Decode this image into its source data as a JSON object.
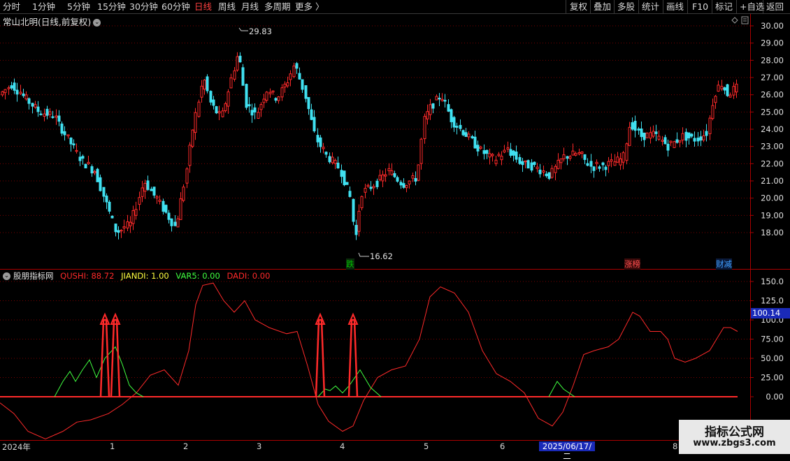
{
  "toolbar": {
    "left_items": [
      "分时",
      "1分钟",
      "5分钟",
      "15分钟",
      "30分钟",
      "60分钟",
      "日线",
      "周线",
      "月线",
      "多周期",
      "更多 〉"
    ],
    "active": "日线",
    "right_items": [
      "复权",
      "叠加",
      "多股",
      "统计",
      "画线",
      "F10",
      "标记",
      "+自选",
      "返回"
    ]
  },
  "price_panel": {
    "title": "常山北明(日线,前复权)",
    "high_label": "29.83",
    "low_label": "16.62",
    "y_ticks": [
      "30.00",
      "29.00",
      "28.00",
      "27.00",
      "26.00",
      "25.00",
      "24.00",
      "23.00",
      "22.00",
      "21.00",
      "20.00",
      "19.00",
      "18.00"
    ],
    "tags": [
      {
        "text": "跌",
        "color": "#00c000"
      },
      {
        "text": "涨榜",
        "color": "#ff5050"
      },
      {
        "text": "财减",
        "color": "#40a0ff"
      }
    ]
  },
  "indicator_panel": {
    "name": "股朋指标网",
    "values": [
      {
        "label": "QUSHI: 88.72",
        "color": "#ff2a2a"
      },
      {
        "label": "JIANDI: 1.00",
        "color": "#ffff40"
      },
      {
        "label": "VAR5: 0.00",
        "color": "#40ff40"
      },
      {
        "label": "DADI: 0.00",
        "color": "#ff2a2a"
      }
    ],
    "y_ticks": [
      "150.0",
      "125.0",
      "100.0",
      "75.00",
      "50.00",
      "25.00",
      "0.00"
    ],
    "current_value": "100.14"
  },
  "x_axis": {
    "labels": [
      "2024年",
      "1",
      "2",
      "3",
      "4",
      "5",
      "6",
      "8"
    ],
    "cursor_date": "2025/06/17/二"
  },
  "watermark": {
    "title": "指标公式网",
    "url": "www.zbgs3.com"
  },
  "colors": {
    "up": "#ff2a2a",
    "down": "#40e0f0",
    "grid": "#7a0000",
    "green_line": "#40ff40"
  }
}
